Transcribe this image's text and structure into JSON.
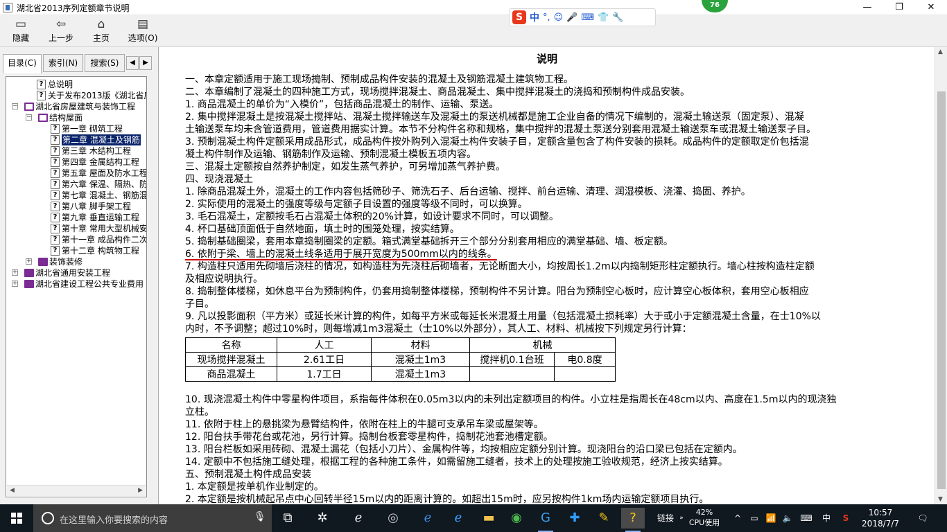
{
  "window": {
    "title": "湖北省2013序列定额章节说明",
    "minimize": "—",
    "restore": "❐",
    "close": "✕"
  },
  "ime": {
    "brand": "S",
    "lang": "中",
    "punct": "°,",
    "emoji": "☺",
    "mic": "🎤",
    "keyboard": "⌨",
    "skin": "👕",
    "tools": "🔧"
  },
  "badge": "76",
  "toolbar": {
    "hide": "隐藏",
    "back": "上一步",
    "home": "主页",
    "options": "选项(O)"
  },
  "tabs": {
    "contents": "目录(C)",
    "index": "索引(N)",
    "search": "搜索(S)",
    "prev": "◀",
    "next": "▶"
  },
  "tree": [
    {
      "label": "总说明",
      "icon": "q",
      "level": 1
    },
    {
      "label": "关于发布2013版《湖北省房屋",
      "icon": "q",
      "level": 1
    },
    {
      "label": "湖北省房屋建筑与装饰工程",
      "icon": "book-open",
      "level": 0,
      "exp": "⊟"
    },
    {
      "label": "结构屋面",
      "icon": "book-open",
      "level": 1,
      "exp": "⊟"
    },
    {
      "label": "第一章 砌筑工程",
      "icon": "q",
      "level": 2
    },
    {
      "label": "第二章 混凝土及钢筋",
      "icon": "q",
      "level": 2,
      "selected": true
    },
    {
      "label": "第三章 木结构工程",
      "icon": "q",
      "level": 2
    },
    {
      "label": "第四章 金属结构工程",
      "icon": "q",
      "level": 2
    },
    {
      "label": "第五章 屋面及防水工程",
      "icon": "q",
      "level": 2
    },
    {
      "label": "第六章 保温、隔热、防",
      "icon": "q",
      "level": 2
    },
    {
      "label": "第七章 混凝土、钢筋混",
      "icon": "q",
      "level": 2
    },
    {
      "label": "第八章 脚手架工程",
      "icon": "q",
      "level": 2
    },
    {
      "label": "第九章 垂直运输工程",
      "icon": "q",
      "level": 2
    },
    {
      "label": "第十章 常用大型机械安",
      "icon": "q",
      "level": 2
    },
    {
      "label": "第十一章 成品构件二次",
      "icon": "q",
      "level": 2
    },
    {
      "label": "第十二章 构筑物工程",
      "icon": "q",
      "level": 2
    },
    {
      "label": "装饰装修",
      "icon": "book",
      "level": 1,
      "exp": "⊞"
    },
    {
      "label": "湖北省通用安装工程",
      "icon": "book",
      "level": 0,
      "exp": "⊞"
    },
    {
      "label": "湖北省建设工程公共专业费用",
      "icon": "book",
      "level": 0,
      "exp": "⊞"
    }
  ],
  "doc": {
    "title": "说明",
    "lines_a": [
      "一、本章定额适用于施工现场搗制、预制成品构件安装的混凝土及钢筋混凝土建筑物工程。",
      "二、本章编制了混凝土的四种施工方式，现场搅拌混凝土、商品混凝土、集中搅拌混凝土的浇捣和预制构件成品安装。",
      "1. 商品混凝土的单价为“入模价”，包括商品混凝土的制作、运输、泵送。",
      "2. 集中搅拌混凝土是按混凝土搅拌站、混凝土搅拌输送车及混凝土的泵送机械都是施工企业自备的情况下编制的，混凝土输送泵（固定泵）、混凝",
      "土输送泵车均未含管道费用，管道费用据实计算。本节不分构件名称和规格，集中搅拌的混凝土泵送分别套用混凝土输送泵车或混凝土输送泵子目。",
      "3. 预制混凝土构件定额采用成品形式，成品构件按外购列入混凝土构件安装子目，定额含量包含了构件安装的损耗。成品构件的定额取定价包括混",
      "凝土构件制作及运输、钢筋制作及运输、预制混凝土模板五项内容。",
      "三、混凝土定额按自然养护制定，如发生蒸气养护，可另增加蒸气养护费。",
      "四、现浇混凝土",
      "1. 除商品混凝土外，混凝土的工作内容包括筛砂子、筛洗石子、后台运输、搅拌、前台运输、清理、润湿模板、浇灌、捣固、养护。",
      "2. 实际使用的混凝土的强度等级与定额子目设置的强度等级不同时，可以换算。",
      "3. 毛石混凝土，定额按毛石占混凝土体积的20%计算，如设计要求不同时，可以调整。",
      "4. 杯口基础顶面低于自然地面，填土时的围笼处理，按实结算。",
      "5. 捣制基础圈梁，套用本章捣制圈梁的定额。箱式满堂基础拆开三个部分分别套用相应的满堂基础、墙、板定额。",
      "6. 依附于梁、墙上的混凝土线条适用于展开宽度为500mm以内的线条。",
      "7. 构造柱只适用先砌墙后浇柱的情况，如构造柱为先浇柱后砌墙者，无论断面大小，均按周长1.2m以内捣制矩形柱定额执行。墙心柱按构造柱定额",
      "及相应说明执行。",
      "8. 捣制整体楼梯，如休息平台为预制构件，仍套用捣制整体楼梯，预制构件不另计算。阳台为预制空心板时，应计算空心板体积，套用空心板相应",
      "子目。",
      "9. 凡以投影面积（平方米）或延长米计算的构件，如每平方米或每延长米混凝土用量（包括混凝土损耗率）大于或小于定额混凝土含量，在士10%以",
      "内时，不予调整；超过10%时，则每增减1m3混凝土（士10%以外部分），其人工、材料、机械按下列规定另行计算："
    ],
    "table": {
      "headers": [
        "名称",
        "人工",
        "材料",
        "机械"
      ],
      "rows": [
        [
          "现场搅拌混凝土",
          "2.61工日",
          "混凝土1m3",
          "搅拌机0.1台班",
          "电0.8度"
        ],
        [
          "商品混凝土",
          "1.7工日",
          "混凝土1m3",
          "",
          ""
        ]
      ]
    },
    "lines_b": [
      "10. 现浇混凝土构件中零星构件项目，系指每件体积在0.05m3以内的未列出定额项目的构件。小立柱是指周长在48cm以内、高度在1.5m以内的现浇独",
      "立柱。",
      "11. 依附于柱上的悬挑梁为悬臂结构件，依附在柱上的牛腿可支承吊车梁或屋架等。",
      "12. 阳台扶手带花台或花池，另行计算。捣制台板套零星构件，捣制花池套池槽定额。",
      "13. 阳台栏板如采用砖砌、混凝土漏花（包括小刀片）、金属构件等，均按相应定额分别计算。现浇阳台的沿口梁已包括在定额内。",
      "14. 定额中不包括施工缝处理，根据工程的各种施工条件，如需留施工缝者，技术上的处理按施工验收规范，经济上按实结算。",
      "五、预制混凝土构件成品安装",
      "1. 本定额是按单机作业制定的。",
      "2. 本定额是按机械起吊点中心回转半径15m以内的距离计算的。如超出15m时，应另按构件1km场内运输定额项目执行。"
    ]
  },
  "taskbar": {
    "search_placeholder": "在这里输入你要搜索的内容",
    "link_label": "链接",
    "cpu_percent": "42%",
    "cpu_label": "CPU使用",
    "ime_lang": "中",
    "time": "10:57",
    "date": "2018/7/7"
  }
}
